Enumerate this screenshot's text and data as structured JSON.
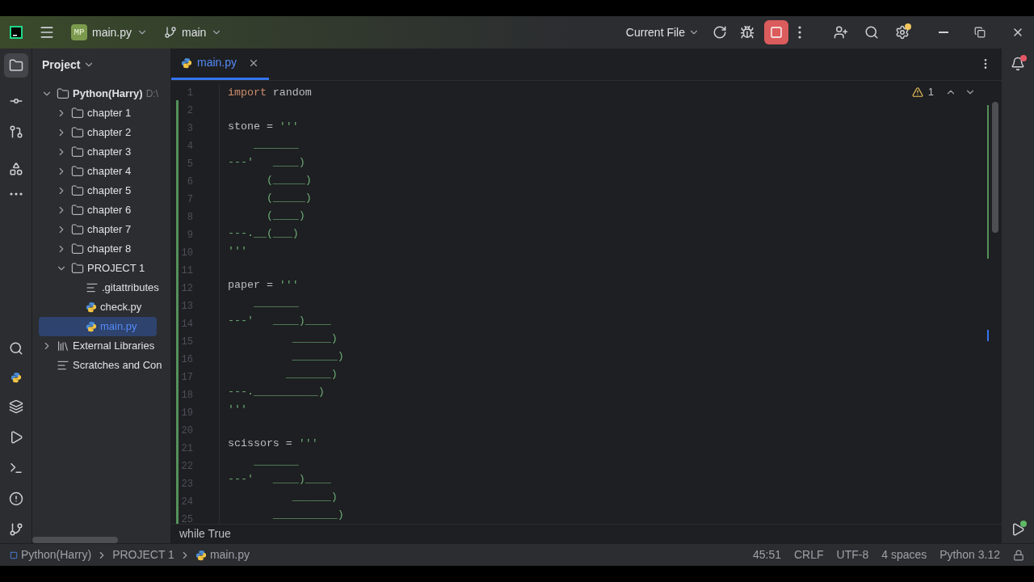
{
  "title_bar": {
    "project_badge": "MP",
    "file": "main.py",
    "branch": "main",
    "run_config": "Current File",
    "stop_active": true,
    "settings_update": true
  },
  "project_panel": {
    "title": "Project",
    "tree": [
      {
        "label": "Python(Harry)",
        "path": "D:\\",
        "kind": "folder",
        "expanded": true,
        "selected": false,
        "children": [
          {
            "label": "chapter 1",
            "kind": "folder",
            "expanded": false,
            "selected": false
          },
          {
            "label": "chapter 2",
            "kind": "folder",
            "expanded": false,
            "selected": false
          },
          {
            "label": "chapter 3",
            "kind": "folder",
            "expanded": false,
            "selected": false
          },
          {
            "label": "chapter 4",
            "kind": "folder",
            "expanded": false,
            "selected": false
          },
          {
            "label": "chapter 5",
            "kind": "folder",
            "expanded": false,
            "selected": false
          },
          {
            "label": "chapter 6",
            "kind": "folder",
            "expanded": false,
            "selected": false
          },
          {
            "label": "chapter 7",
            "kind": "folder",
            "expanded": false,
            "selected": false
          },
          {
            "label": "chapter 8",
            "kind": "folder",
            "expanded": false,
            "selected": false
          },
          {
            "label": "PROJECT 1",
            "kind": "folder",
            "expanded": true,
            "selected": false,
            "children": [
              {
                "label": ".gitattributes",
                "kind": "text",
                "selected": false
              },
              {
                "label": "check.py",
                "kind": "python",
                "selected": false
              },
              {
                "label": "main.py",
                "kind": "python",
                "selected": true
              }
            ]
          }
        ]
      },
      {
        "label": "External Libraries",
        "kind": "library",
        "expanded": false,
        "selected": false
      },
      {
        "label": "Scratches and Con",
        "kind": "scratch",
        "selected": false
      }
    ]
  },
  "editor": {
    "tabs": [
      {
        "label": "main.py",
        "selected": true
      }
    ],
    "warnings": "1",
    "lines": [
      {
        "n": "1",
        "tokens": [
          {
            "kind": "keyword",
            "text": "import"
          },
          {
            "kind": "plain",
            "text": " random"
          }
        ]
      },
      {
        "n": "2"
      },
      {
        "n": "3",
        "tokens": [
          {
            "kind": "plain",
            "text": "stone = "
          },
          {
            "kind": "string",
            "text": "'''"
          }
        ]
      },
      {
        "n": "4",
        "tokens": [
          {
            "kind": "string",
            "text": "    _______"
          }
        ]
      },
      {
        "n": "5",
        "tokens": [
          {
            "kind": "string",
            "text": "---'   ____)"
          }
        ]
      },
      {
        "n": "6",
        "tokens": [
          {
            "kind": "string",
            "text": "      (_____)"
          }
        ]
      },
      {
        "n": "7",
        "tokens": [
          {
            "kind": "string",
            "text": "      (_____)"
          }
        ]
      },
      {
        "n": "8",
        "tokens": [
          {
            "kind": "string",
            "text": "      (____)"
          }
        ]
      },
      {
        "n": "9",
        "tokens": [
          {
            "kind": "string",
            "text": "---.__(___)"
          }
        ]
      },
      {
        "n": "10",
        "tokens": [
          {
            "kind": "string",
            "text": "'''"
          }
        ]
      },
      {
        "n": "11"
      },
      {
        "n": "12",
        "tokens": [
          {
            "kind": "plain",
            "text": "paper = "
          },
          {
            "kind": "string",
            "text": "'''"
          }
        ]
      },
      {
        "n": "13",
        "tokens": [
          {
            "kind": "string",
            "text": "    _______"
          }
        ]
      },
      {
        "n": "14",
        "tokens": [
          {
            "kind": "string",
            "text": "---'   ____)____"
          }
        ]
      },
      {
        "n": "15",
        "tokens": [
          {
            "kind": "string",
            "text": "          ______)"
          }
        ]
      },
      {
        "n": "16",
        "tokens": [
          {
            "kind": "string",
            "text": "          _______)"
          }
        ]
      },
      {
        "n": "17",
        "tokens": [
          {
            "kind": "string",
            "text": "         _______)"
          }
        ]
      },
      {
        "n": "18",
        "tokens": [
          {
            "kind": "string",
            "text": "---.__________)"
          }
        ]
      },
      {
        "n": "19",
        "tokens": [
          {
            "kind": "string",
            "text": "'''"
          }
        ]
      },
      {
        "n": "20"
      },
      {
        "n": "21",
        "tokens": [
          {
            "kind": "plain",
            "text": "scissors = "
          },
          {
            "kind": "string",
            "text": "'''"
          }
        ]
      },
      {
        "n": "22",
        "tokens": [
          {
            "kind": "string",
            "text": "    _______"
          }
        ]
      },
      {
        "n": "23",
        "tokens": [
          {
            "kind": "string",
            "text": "---'   ____)____"
          }
        ]
      },
      {
        "n": "24",
        "tokens": [
          {
            "kind": "string",
            "text": "          ______)"
          }
        ]
      },
      {
        "n": "25",
        "tokens": [
          {
            "kind": "string",
            "text": "       __________)"
          }
        ]
      }
    ],
    "breadcrumb": "while True"
  },
  "status_bar": {
    "path": [
      "Python(Harry)",
      "PROJECT 1",
      "main.py"
    ],
    "position": "45:51",
    "line_ending": "CRLF",
    "encoding": "UTF-8",
    "indent": "4 spaces",
    "interpreter": "Python 3.12"
  }
}
